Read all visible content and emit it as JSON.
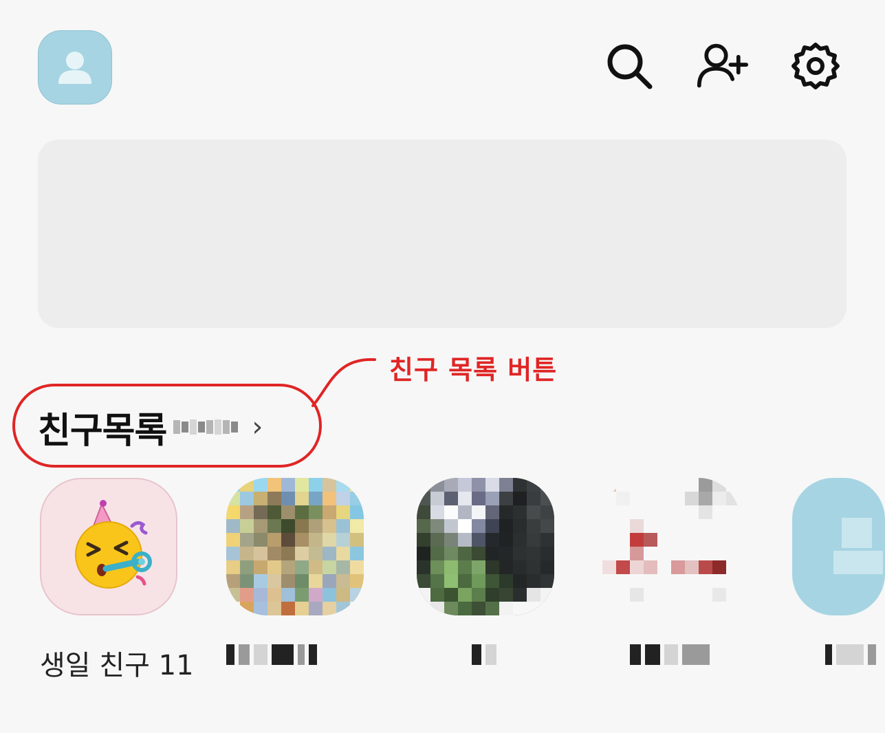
{
  "header": {
    "my_profile_icon": "person-icon",
    "actions": [
      {
        "name": "search-icon"
      },
      {
        "name": "add-friend-icon"
      },
      {
        "name": "settings-gear-icon"
      }
    ]
  },
  "annotation": {
    "label": "친구 목록 버튼",
    "color": "#e02525"
  },
  "friends": {
    "title": "친구목록",
    "chevron": "›"
  },
  "birthday": {
    "label": "생일 친구 11",
    "icon": "party-face-emoji"
  }
}
